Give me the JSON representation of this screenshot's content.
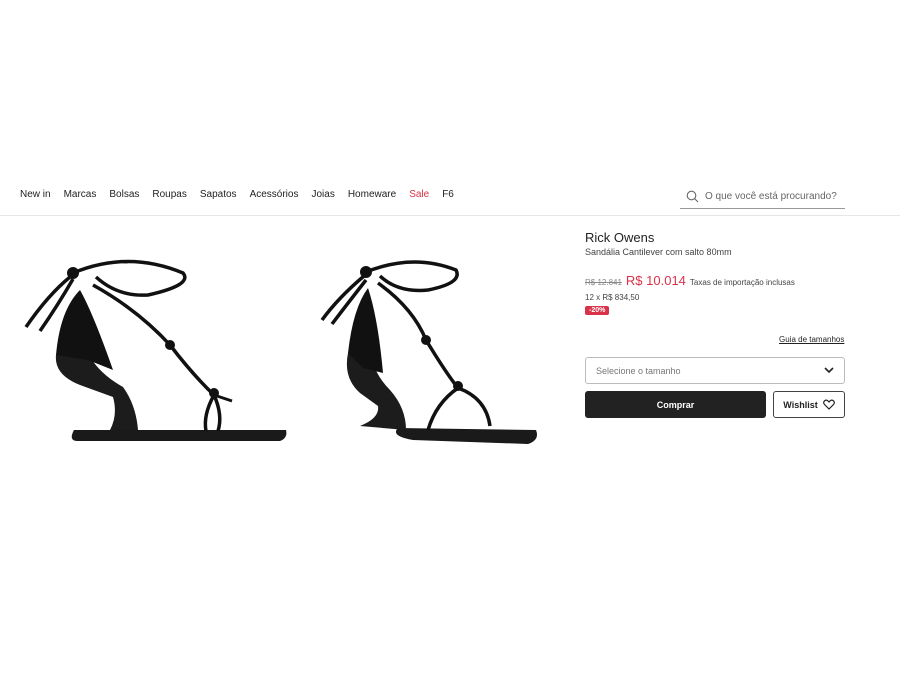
{
  "nav": {
    "items": [
      {
        "label": "New in"
      },
      {
        "label": "Marcas"
      },
      {
        "label": "Bolsas"
      },
      {
        "label": "Roupas"
      },
      {
        "label": "Sapatos"
      },
      {
        "label": "Acessórios"
      },
      {
        "label": "Joias"
      },
      {
        "label": "Homeware"
      },
      {
        "label": "Sale"
      },
      {
        "label": "F6"
      }
    ]
  },
  "search": {
    "placeholder": "O que você está procurando?",
    "icon": "search-icon"
  },
  "product": {
    "brand": "Rick Owens",
    "name": "Sandália Cantilever com salto 80mm",
    "old_price": "R$ 12.841",
    "price": "R$ 10.014",
    "tax_note": "Taxas de importação inclusas",
    "installments": "12 x R$ 834,50",
    "discount": "-20%",
    "size_guide": "Guia de tamanhos",
    "size_placeholder": "Selecione o tamanho",
    "buy_label": "Comprar",
    "wishlist_label": "Wishlist"
  },
  "colors": {
    "accent": "#d8334a",
    "button_dark": "#222222"
  }
}
